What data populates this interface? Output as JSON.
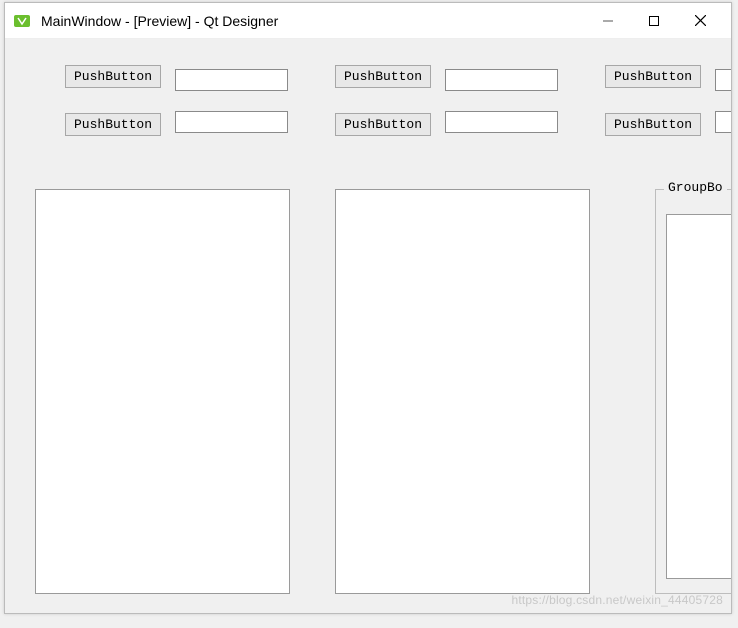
{
  "window": {
    "title": "MainWindow - [Preview] - Qt Designer"
  },
  "controls": {
    "minimize": "—",
    "maximize": "☐",
    "close": "✕"
  },
  "buttons": {
    "b1": "PushButton",
    "b2": "PushButton",
    "b3": "PushButton",
    "b4": "PushButton",
    "b5": "PushButton",
    "b6": "PushButton"
  },
  "inputs": {
    "i1": "",
    "i2": "",
    "i3": "",
    "i4": ""
  },
  "groupbox": {
    "title": "GroupBo"
  },
  "watermark": "https://blog.csdn.net/weixin_44405728"
}
